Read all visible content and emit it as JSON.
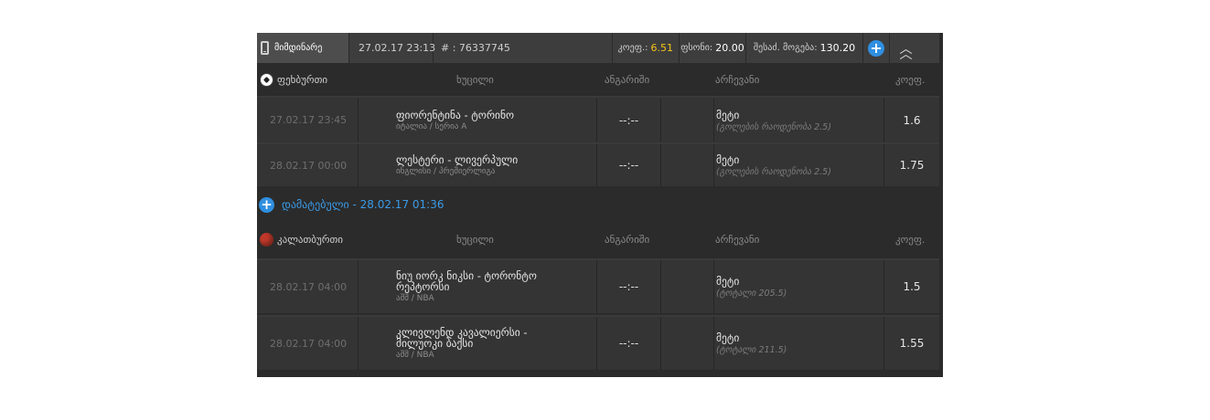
{
  "topbar": {
    "status_label": "მიმდინარე",
    "date": "27.02.17 23:13",
    "ticket_id": "# : 76337745",
    "odds_label": "კოეფ.:",
    "odds_value": "6.51",
    "stake_label": "ფსონი:",
    "stake_value": "20.00",
    "possible_win_label": "შესაძ. მოგება:",
    "possible_win_value": "130.20"
  },
  "columns": {
    "event": "ხუცილი",
    "score": "ანგარიში",
    "selection": "არჩევანი",
    "odds": "კოეფ."
  },
  "groups": [
    {
      "sport": "ფეხბურთი",
      "events": [
        {
          "date": "27.02.17 23:45",
          "teams": "ფიორენტინა - ტორინო",
          "league": "იტალია / სერია A",
          "score": "--:--",
          "selection": "მეტი",
          "market": "(გოლების რაოდენობა 2.5)",
          "odds": "1.6"
        },
        {
          "date": "28.02.17 00:00",
          "teams": "ლესტერი - ლივერპული",
          "league": "ინგლისი / პრემიერლიგა",
          "score": "--:--",
          "selection": "მეტი",
          "market": "(გოლების რაოდენობა 2.5)",
          "odds": "1.75"
        }
      ]
    },
    {
      "sport": "კალათბურთი",
      "events": [
        {
          "date": "28.02.17 04:00",
          "teams": "ნიუ იორკ ნიკსი - ტორონტო რეპტორსი",
          "league": "აშშ / NBA",
          "score": "--:--",
          "selection": "მეტი",
          "market": "(ტოტალი 205.5)",
          "odds": "1.5"
        },
        {
          "date": "28.02.17 04:00",
          "teams": "კლივლენდ კავალიერსი - მილუოკი ბაქსი",
          "league": "აშშ / NBA",
          "score": "--:--",
          "selection": "მეტი",
          "market": "(ტოტალი 211.5)",
          "odds": "1.55"
        }
      ]
    }
  ],
  "added_label": "დამატებული - 28.02.17 01:36",
  "colors": {
    "accent_blue": "#2f8fe0",
    "odds_yellow": "#f5c518"
  }
}
